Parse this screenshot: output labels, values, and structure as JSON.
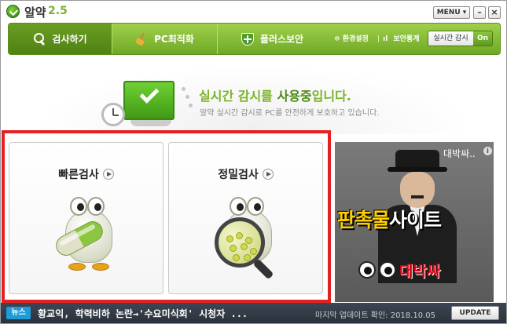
{
  "app": {
    "name": "알약",
    "version": "2.5"
  },
  "titlebar": {
    "menu_label": "MENU ▾",
    "minimize_label": "–",
    "close_label": "×"
  },
  "nav": {
    "tabs": [
      {
        "label": "검사하기",
        "icon": "search-icon",
        "active": true
      },
      {
        "label": "PC최적화",
        "icon": "broom-icon",
        "active": false
      },
      {
        "label": "플러스보안",
        "icon": "shield-plus-icon",
        "active": false
      }
    ],
    "links": {
      "settings": "환경설정",
      "stats": "보안통계"
    },
    "realtime": {
      "label": "실시간 감시",
      "state": "On"
    }
  },
  "status": {
    "title_prefix": "실시간 감시를 ",
    "title_emph": "사용중",
    "title_suffix": "입니다.",
    "description": "알약 실시간 감시로 PC를 안전하게 보호하고 있습니다."
  },
  "scan": {
    "quick": {
      "label": "빠른검사"
    },
    "deep": {
      "label": "정밀검사"
    }
  },
  "ad": {
    "top_text": "대박싸..",
    "info": "i",
    "headline_a": "판촉물",
    "headline_b": "사이트",
    "brand": "대박싸"
  },
  "bottom": {
    "news_badge": "뉴스",
    "news_text": "황교익, 학력비하 논란→'수요미식회' 시청자 ...",
    "update_info": "마지막 업데이트 확인: 2018.10.05",
    "update_button": "UPDATE"
  },
  "colors": {
    "accent_green": "#7ab32a",
    "highlight_red": "#e62020",
    "news_blue": "#1f9bd6"
  }
}
